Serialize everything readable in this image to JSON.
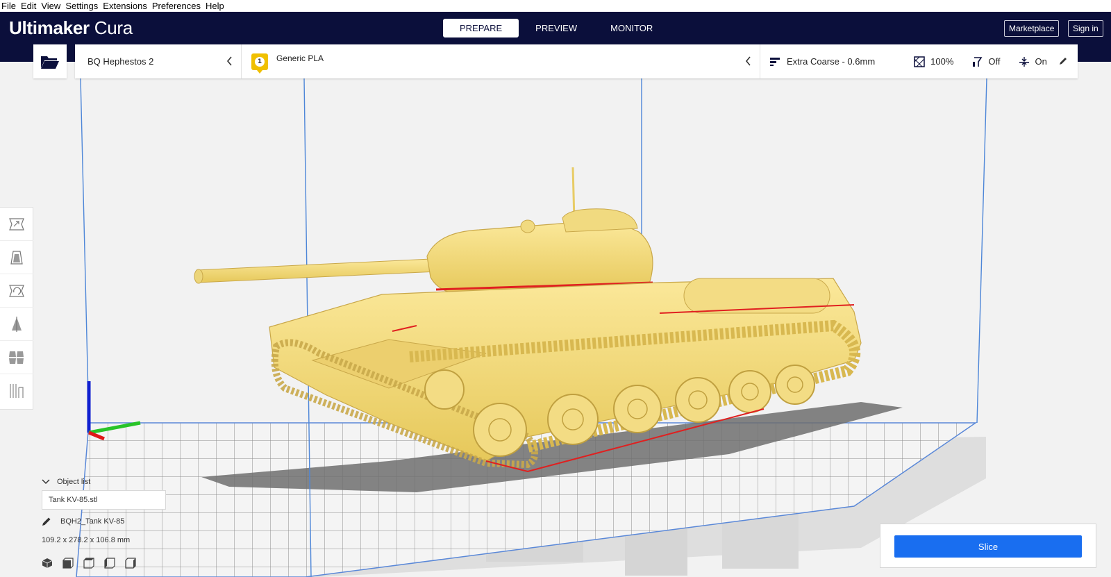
{
  "menu": [
    "File",
    "Edit",
    "View",
    "Settings",
    "Extensions",
    "Preferences",
    "Help"
  ],
  "header": {
    "logo_bold": "Ultimaker",
    "logo_light": " Cura",
    "stages": [
      "PREPARE",
      "PREVIEW",
      "MONITOR"
    ],
    "active_stage": "PREPARE",
    "marketplace_label": "Marketplace",
    "signin_label": "Sign in"
  },
  "toolbar": {
    "printer": "BQ Hephestos 2",
    "extruder_number": "1",
    "material": "Generic PLA",
    "profile": "Extra Coarse - 0.6mm",
    "infill": "100%",
    "support": "Off",
    "adhesion": "On"
  },
  "objects": {
    "header": "Object list",
    "items": [
      "Tank KV-85.stl"
    ],
    "selected_name": "BQH2_Tank KV-85",
    "dimensions": "109.2 x 278.2 x 106.8 mm"
  },
  "action": {
    "slice_label": "Slice"
  },
  "colors": {
    "header_bg": "#0b0f3b",
    "accent": "#196ef0",
    "model": "#f5dd7c",
    "overhang": "#e02020"
  }
}
